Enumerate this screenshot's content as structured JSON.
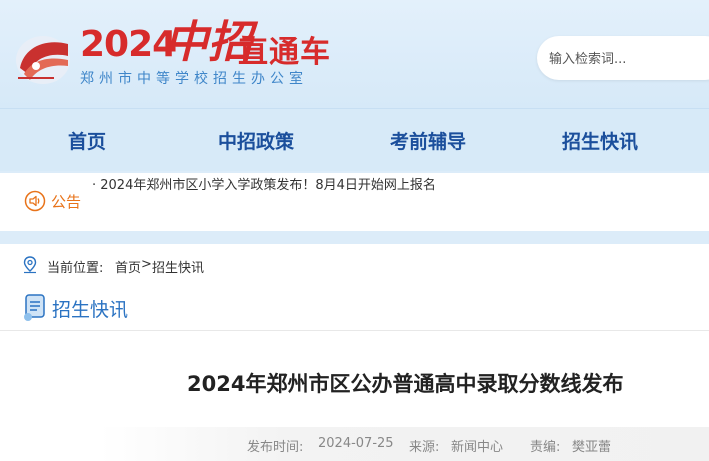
{
  "header": {
    "logo_year": "2024",
    "logo_zhongzhao": "中招",
    "logo_zhitongche": "直通车",
    "logo_office": "郑州市中等学校招生办公室",
    "search_placeholder": "输入检索词..."
  },
  "nav": {
    "items": [
      {
        "label": "首页"
      },
      {
        "label": "中招政策"
      },
      {
        "label": "考前辅导"
      },
      {
        "label": "招生快讯"
      }
    ]
  },
  "notice": {
    "label": "公告",
    "text": "· 2024年郑州市区小学入学政策发布！8月4日开始网上报名"
  },
  "breadcrumb": {
    "label": "当前位置:",
    "home": "首页",
    "sep": ">",
    "category": "招生快讯"
  },
  "section": {
    "title": "招生快讯"
  },
  "article": {
    "title": "2024年郑州市区公办普通高中录取分数线发布",
    "publish_label": "发布时间:",
    "publish_date": "2024-07-25",
    "source_label": "来源:",
    "source": "新闻中心",
    "editor_label": "责编:",
    "editor": "樊亚蕾"
  },
  "colors": {
    "brand_red": "#d72b2b",
    "nav_blue": "#1b4f9c",
    "notice_orange": "#e8731a",
    "section_blue": "#2b73c2"
  },
  "icons": {
    "logo": "train-icon",
    "notice": "speaker-icon",
    "location": "location-pin-icon",
    "section": "document-icon"
  }
}
